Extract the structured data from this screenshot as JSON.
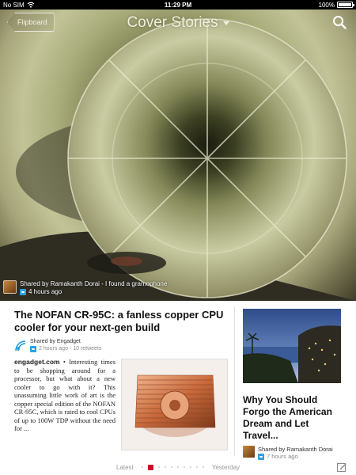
{
  "status_bar": {
    "carrier": "No SIM",
    "time": "11:29 PM",
    "battery": "100%",
    "battery_level": 1.0
  },
  "header": {
    "back_label": "Flipboard",
    "title": "Cover Stories"
  },
  "cover": {
    "credit_line": "Shared by Ramakanth Dorai - I found a gramophone",
    "credit_time": "4 hours ago"
  },
  "main_article": {
    "headline": "The NOFAN CR-95C: a fanless copper CPU cooler for your next-gen build",
    "source": "Shared by Engadget",
    "meta": "2 hours ago - 10 retweets",
    "excerpt_source": "engadget.com",
    "excerpt_text": "Interesting times to be shopping around for a processor, but what about a new cooler to go with it? This unassuming little work of art is the copper special edition of the NOFAN CR-95C, which is rated to cool CPUs of up to 100W TDP without the need for ..."
  },
  "side_article": {
    "headline": "Why You Should Forgo the American Dream and Let Travel...",
    "credit": "Shared by Ramakanth Dorai",
    "time": "7 hours ago"
  },
  "footer": {
    "latest_label": "Latest",
    "yesterday_label": "Yesterday"
  },
  "colors": {
    "accent": "#c8102e",
    "twitter": "#2ea0de"
  },
  "icons": [
    "wifi-icon",
    "search-icon",
    "twitter-icon",
    "engadget-icon",
    "compose-icon"
  ]
}
